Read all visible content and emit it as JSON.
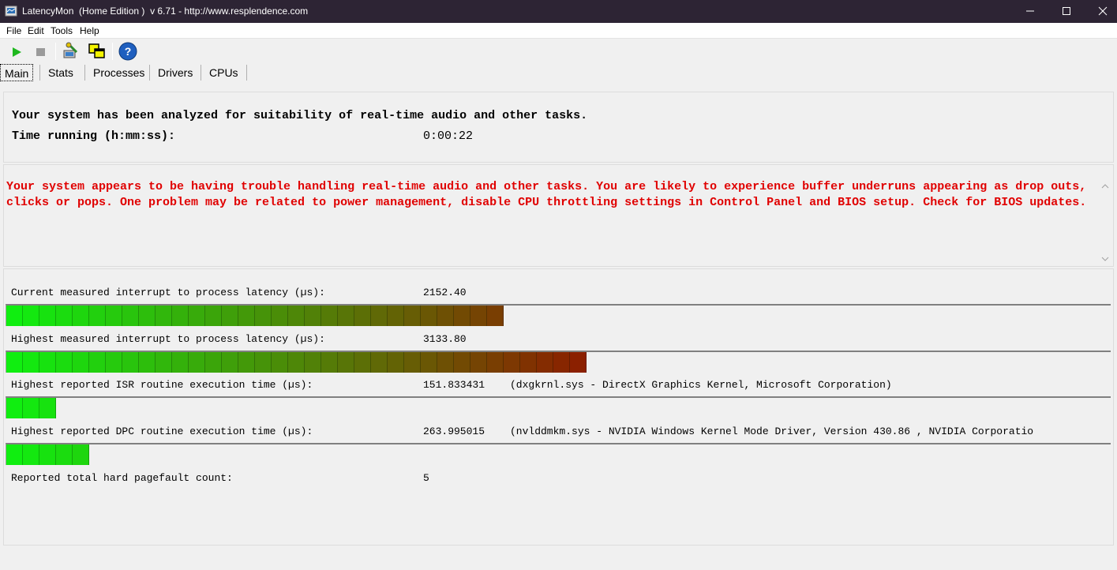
{
  "window": {
    "title": "LatencyMon  (Home Edition )  v 6.71 - http://www.resplendence.com",
    "minimize_icon": "minimize-icon",
    "maximize_icon": "maximize-icon",
    "close_icon": "close-icon"
  },
  "menu": {
    "file": "File",
    "edit": "Edit",
    "tools": "Tools",
    "help": "Help"
  },
  "toolbar": {
    "icons": [
      "play-icon",
      "stop-icon",
      "driver-tool-icon",
      "windows-icon",
      "help-icon"
    ]
  },
  "tabs": [
    "Main",
    "Stats",
    "Processes",
    "Drivers",
    "CPUs"
  ],
  "summary": {
    "analysis_line": "Your system has been analyzed for suitability of real-time audio and other tasks.",
    "time_label": "Time running (h:mm:ss):",
    "time_value": "0:00:22"
  },
  "warning": {
    "text": "Your system appears to be having trouble handling real-time audio and other tasks. You are likely to experience buffer underruns appearing as drop outs, clicks or pops. One problem may be related to power management, disable CPU throttling settings in Control Panel and BIOS setup. Check for BIOS updates.",
    "color": "#e00000"
  },
  "stats": [
    {
      "label": "Current measured interrupt to process latency (µs):",
      "value": "2152.40",
      "detail": "",
      "bar_segments": 30
    },
    {
      "label": "Highest measured interrupt to process latency (µs):",
      "value": "3133.80",
      "detail": "",
      "bar_segments": 35
    },
    {
      "label": "Highest reported ISR routine execution time (µs):",
      "value": "151.833431",
      "detail": "(dxgkrnl.sys - DirectX Graphics Kernel, Microsoft Corporation)",
      "bar_segments": 3
    },
    {
      "label": "Highest reported DPC routine execution time (µs):",
      "value": "263.995015",
      "detail": "(nvlddmkm.sys - NVIDIA Windows Kernel Mode Driver, Version 430.86 , NVIDIA Corporatio",
      "bar_segments": 5
    }
  ],
  "pagefault": {
    "label": "Reported total hard pagefault count:",
    "value": "5"
  },
  "colors": {
    "bar_start": "#10ee10",
    "bar_end": "#8b2000",
    "titlebar": "#2d2434"
  }
}
